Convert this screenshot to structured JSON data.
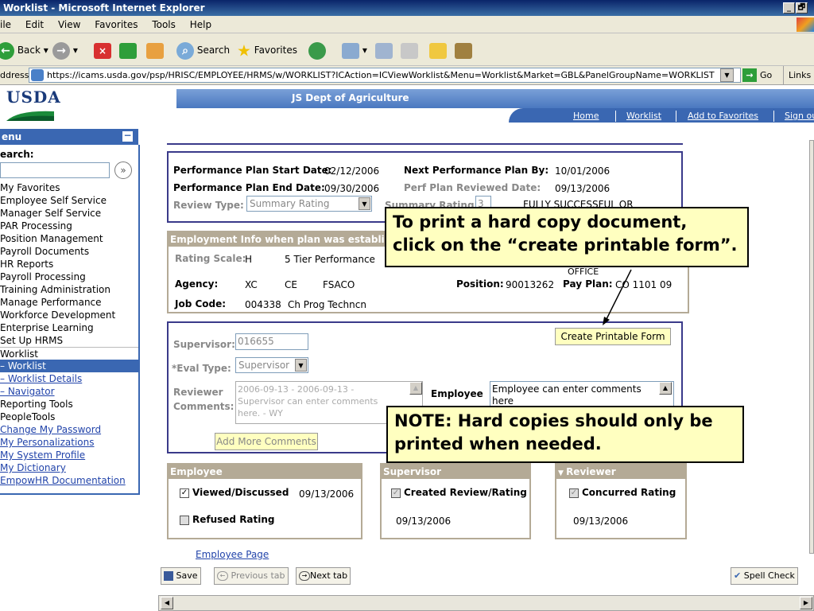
{
  "window": {
    "title": "Worklist - Microsoft Internet Explorer",
    "controls": [
      "_",
      "🗗"
    ]
  },
  "menubar": [
    "ile",
    "Edit",
    "View",
    "Favorites",
    "Tools",
    "Help"
  ],
  "toolbar": {
    "back": "Back",
    "search": "Search",
    "favorites": "Favorites"
  },
  "address": {
    "label": "ddress",
    "url": "https://icams.usda.gov/psp/HRISC/EMPLOYEE/HRMS/w/WORKLIST?ICAction=ICViewWorklist&Menu=Worklist&Market=GBL&PanelGroupName=WORKLIST",
    "go": "Go",
    "links": "Links"
  },
  "header": {
    "logo": "USDA",
    "org": "JS Dept of Agriculture",
    "nav": [
      "Home",
      "Worklist",
      "Add to Favorites",
      "Sign ou"
    ]
  },
  "menu": {
    "title": "enu",
    "search_label": "earch:",
    "items": [
      {
        "label": "My Favorites",
        "style": "plain"
      },
      {
        "label": "Employee Self Service",
        "style": "plain"
      },
      {
        "label": "Manager Self Service",
        "style": "plain"
      },
      {
        "label": "PAR Processing",
        "style": "plain"
      },
      {
        "label": "Position Management",
        "style": "plain"
      },
      {
        "label": "Payroll Documents",
        "style": "plain"
      },
      {
        "label": "HR Reports",
        "style": "plain"
      },
      {
        "label": "Payroll Processing",
        "style": "plain"
      },
      {
        "label": "Training Administration",
        "style": "plain"
      },
      {
        "label": "Manage Performance",
        "style": "plain"
      },
      {
        "label": "Workforce Development",
        "style": "plain"
      },
      {
        "label": "Enterprise Learning",
        "style": "plain"
      },
      {
        "label": "Set Up HRMS",
        "style": "plain"
      },
      {
        "label": "Worklist",
        "style": "section"
      },
      {
        "label": "– Worklist",
        "style": "selected"
      },
      {
        "label": "– Worklist Details",
        "style": "sublink"
      },
      {
        "label": "– Navigator",
        "style": "sublink"
      },
      {
        "label": "Reporting Tools",
        "style": "plain"
      },
      {
        "label": "PeopleTools",
        "style": "plain"
      },
      {
        "label": "Change My Password",
        "style": "link"
      },
      {
        "label": "My Personalizations",
        "style": "link"
      },
      {
        "label": "My System Profile",
        "style": "link"
      },
      {
        "label": "My Dictionary",
        "style": "link"
      },
      {
        "label": "EmpowHR Documentation",
        "style": "link"
      }
    ]
  },
  "plan": {
    "start_label": "Performance Plan Start Date:",
    "start_value": "02/12/2006",
    "end_label": "Performance Plan End Date:",
    "end_value": "09/30/2006",
    "next_label": "Next Performance Plan By:",
    "next_value": "10/01/2006",
    "reviewed_label": "Perf Plan Reviewed Date:",
    "reviewed_value": "09/13/2006",
    "review_type_label": "Review Type:",
    "review_type_value": "Summary Rating",
    "summary_rating_label": "Summary Rating:",
    "summary_rating_value": "3",
    "summary_rating_text": "FULLY SUCCESSFUL OR"
  },
  "employment": {
    "header": "Employment Info when plan was established",
    "rating_scale_label": "Rating Scale:",
    "rating_scale_code": "H",
    "rating_scale_text": "5 Tier Performance",
    "office": "OFFICE",
    "agency_label": "Agency:",
    "agency_values": [
      "XC",
      "CE",
      "FSACO"
    ],
    "position_label": "Position:",
    "position_value": "90013262",
    "payplan_label": "Pay Plan:",
    "payplan_value": "CO  1101  09",
    "jobcode_label": "Job Code:",
    "jobcode_value": "004338",
    "jobcode_text": "Ch Prog Techncn"
  },
  "review": {
    "create_form_button": "Create Printable Form",
    "supervisor_label": "Supervisor:",
    "supervisor_value": "016655",
    "eval_type_label": "*Eval Type:",
    "eval_type_value": "Supervisor",
    "reviewer_label": "Reviewer",
    "comments_label": "Comments:",
    "reviewer_comments": [
      "2006-09-13 - 2006-09-13 -",
      "Supervisor can enter comments",
      "here. - WY"
    ],
    "employee_label": "Employee",
    "employee_comments": [
      "Employee can enter comments",
      "here"
    ],
    "add_comments_button": "Add More Comments"
  },
  "employee_box": {
    "header": "Employee",
    "viewed_label": "Viewed/Discussed",
    "viewed_date": "09/13/2006",
    "refused_label": "Refused Rating"
  },
  "supervisor_box": {
    "header": "Supervisor",
    "created_label": "Created Review/Rating",
    "created_date": "09/13/2006"
  },
  "reviewer_box": {
    "header": "Reviewer",
    "concurred_label": "Concurred Rating",
    "concurred_date": "09/13/2006"
  },
  "footer": {
    "employee_page_link": "Employee Page",
    "save": "Save",
    "previous_tab": "Previous tab",
    "next_tab": "Next tab",
    "spell_check": "Spell Check"
  },
  "callouts": {
    "print_line1": "To print a hard copy document,",
    "print_line2": "click on the “create printable form”.",
    "note_line1": "NOTE:  Hard copies should only be",
    "note_line2": "printed when needed."
  },
  "colors": {
    "title_bar": "#0a246a",
    "nav_blue": "#3a67b2",
    "section_tan": "#b4aa96",
    "callout_yellow": "#ffffc0"
  }
}
